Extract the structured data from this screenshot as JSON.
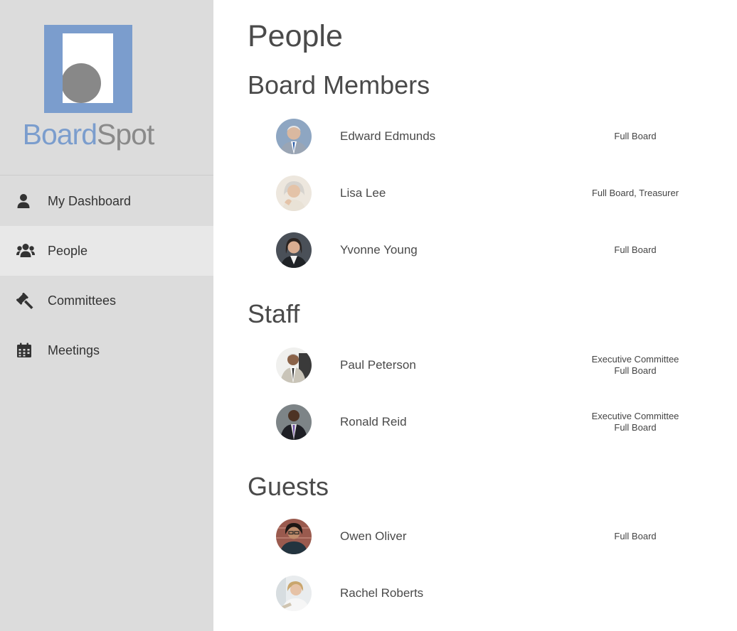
{
  "brand": {
    "name_part1": "Board",
    "name_part2": "Spot",
    "color_primary": "#7b9dcd",
    "color_secondary": "#8a8a8a"
  },
  "sidebar": {
    "items": [
      {
        "label": "My Dashboard",
        "icon": "user-icon",
        "active": false
      },
      {
        "label": "People",
        "icon": "users-icon",
        "active": true
      },
      {
        "label": "Committees",
        "icon": "gavel-icon",
        "active": false
      },
      {
        "label": "Meetings",
        "icon": "calendar-icon",
        "active": false
      }
    ]
  },
  "main": {
    "title": "People",
    "sections": [
      {
        "title": "Board Members",
        "people": [
          {
            "name": "Edward Edmunds",
            "roles": [
              "Full Board"
            ]
          },
          {
            "name": "Lisa Lee",
            "roles": [
              "Full Board, Treasurer"
            ]
          },
          {
            "name": "Yvonne Young",
            "roles": [
              "Full Board"
            ]
          }
        ]
      },
      {
        "title": "Staff",
        "people": [
          {
            "name": "Paul Peterson",
            "roles": [
              "Executive Committee",
              "Full Board"
            ]
          },
          {
            "name": "Ronald Reid",
            "roles": [
              "Executive Committee",
              "Full Board"
            ]
          }
        ]
      },
      {
        "title": "Guests",
        "people": [
          {
            "name": "Owen Oliver",
            "roles": [
              "Full Board"
            ]
          },
          {
            "name": "Rachel Roberts",
            "roles": []
          }
        ]
      }
    ]
  }
}
